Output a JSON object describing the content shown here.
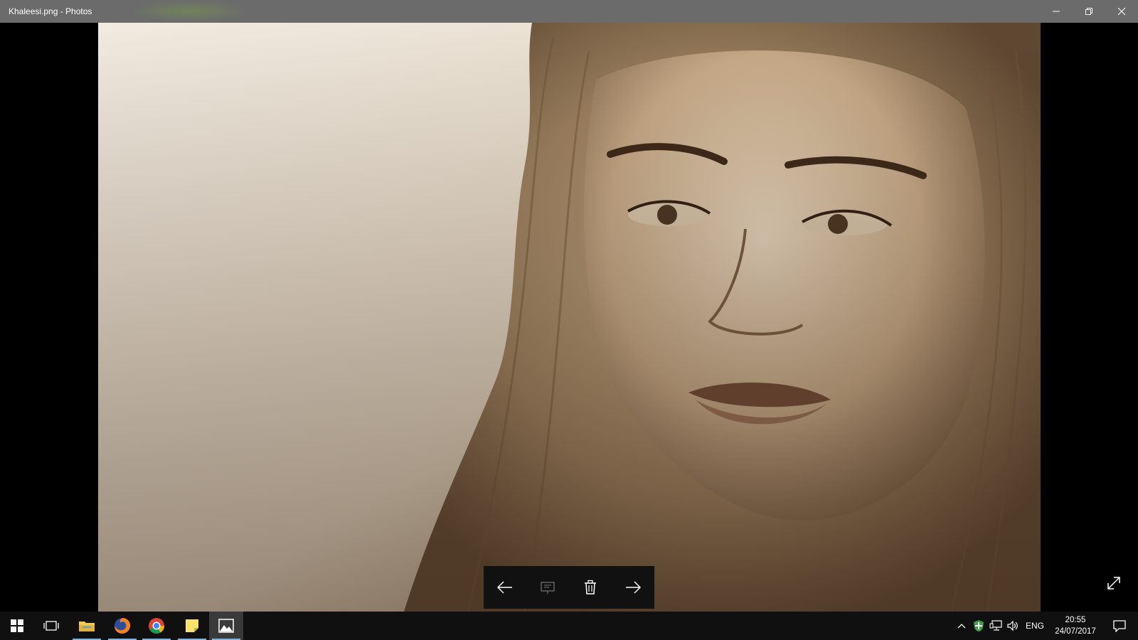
{
  "window": {
    "title": "Khaleesi.png - Photos",
    "controls": [
      "minimize-icon",
      "restore-icon",
      "close-icon"
    ]
  },
  "viewer": {
    "image_description_name": "sepia-portrait-photo",
    "toolbar": [
      "back-arrow-icon",
      "slideshow-icon",
      "delete-icon",
      "forward-arrow-icon"
    ],
    "fullscreen_icon": "expand-icon"
  },
  "taskbar": {
    "pinned": [
      "windows-start-icon",
      "task-view-icon",
      "file-explorer-icon",
      "firefox-icon",
      "chrome-icon",
      "sticky-notes-icon",
      "photos-icon"
    ],
    "language": "ENG",
    "time": "20:55",
    "date": "24/07/2017"
  },
  "colors": {
    "titlebar": "#6b6b6b",
    "taskbar": "#101010",
    "running_indicator": "#7fb3d8"
  }
}
